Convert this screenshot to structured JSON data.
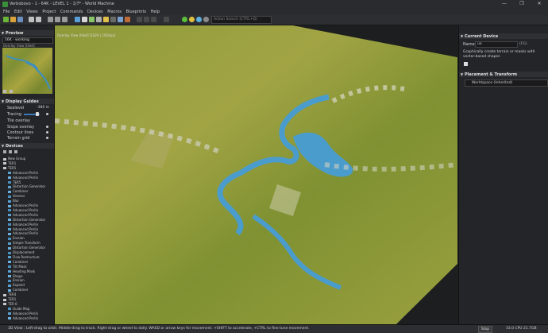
{
  "window": {
    "title": "Verbobovo - 1 - 64K - LEVEL 1 - 1/7* - World Machine",
    "min": "—",
    "max": "❐",
    "close": "✕"
  },
  "menu": [
    "File",
    "Edit",
    "Views",
    "Project",
    "Commands",
    "Devices",
    "Macros",
    "Blueprints",
    "Help"
  ],
  "toolbar": {
    "action_search_placeholder": "Action Search (CTRL+Q)"
  },
  "preview": {
    "header": "Preview",
    "selected": "16K - working",
    "overlay_label": "Overlay View [tiled]"
  },
  "display_guides": {
    "header": "Display Guides",
    "sealevel_label": "Sealevel",
    "sealevel_value": "-386 m",
    "tracing_label": "Tracing",
    "tile_overlay": "Tile overlay",
    "slope_overlay": "Slope overlay",
    "contour_lines": "Contour lines",
    "terrain_grid": "Terrain grid"
  },
  "devices": {
    "header": "Devices",
    "items": [
      {
        "label": "New Group",
        "kind": "group"
      },
      {
        "label": "TER1",
        "kind": "group"
      },
      {
        "label": "TER5",
        "kind": "group"
      },
      {
        "label": "Advanced Perlin",
        "kind": "node"
      },
      {
        "label": "Advanced Perlin",
        "kind": "node"
      },
      {
        "label": "TER5",
        "kind": "node"
      },
      {
        "label": "Distortion Generator",
        "kind": "node"
      },
      {
        "label": "Combiner",
        "kind": "node"
      },
      {
        "label": "Voronoi",
        "kind": "node"
      },
      {
        "label": "Blur",
        "kind": "node"
      },
      {
        "label": "Advanced Perlin",
        "kind": "node"
      },
      {
        "label": "Advanced Perlin",
        "kind": "node"
      },
      {
        "label": "Advanced Perlin",
        "kind": "node"
      },
      {
        "label": "Distortion Generator",
        "kind": "node"
      },
      {
        "label": "Advanced Perlin",
        "kind": "node"
      },
      {
        "label": "Advanced Perlin",
        "kind": "node"
      },
      {
        "label": "Advanced Perlin",
        "kind": "node"
      },
      {
        "label": "Erosion",
        "kind": "node"
      },
      {
        "label": "Simple Transform",
        "kind": "node"
      },
      {
        "label": "Distortion Generator",
        "kind": "node"
      },
      {
        "label": "Displacement",
        "kind": "node"
      },
      {
        "label": "Flow Restructure",
        "kind": "node"
      },
      {
        "label": "Combiner",
        "kind": "node"
      },
      {
        "label": "Tilt Mask",
        "kind": "node"
      },
      {
        "label": "Heading Mask",
        "kind": "node"
      },
      {
        "label": "Shape",
        "kind": "node"
      },
      {
        "label": "Erosion",
        "kind": "node"
      },
      {
        "label": "Expand",
        "kind": "node"
      },
      {
        "label": "Combiner",
        "kind": "node"
      },
      {
        "label": "TER4",
        "kind": "group"
      },
      {
        "label": "TER1",
        "kind": "group"
      },
      {
        "label": "TER 6",
        "kind": "group"
      },
      {
        "label": "Guide Map",
        "kind": "node"
      },
      {
        "label": "Advanced Perlin",
        "kind": "node"
      },
      {
        "label": "Advanced Perlin",
        "kind": "node"
      }
    ]
  },
  "viewport": {
    "label": "Overlay View [tiled] [1024 | 1024px]"
  },
  "current_device": {
    "header": "Current Device",
    "name_label": "Name",
    "name_value": "ue",
    "name_extra": "(FG)",
    "description": "Graphically create terrain or masks with vector-based shapes"
  },
  "placement": {
    "header": "Placement & Transform",
    "selected": "Worldspace (Inherited)"
  },
  "status": {
    "text": "3D View : Left-drag to orbit. Middle-drag to track. Right-drag or wheel to dolly. WASD or arrow keys for movement. +SHIFT to accelerate, +CTRL to fine tune movement.",
    "stop": "Stop",
    "perf": "33.0 CPU 21.7GB"
  },
  "colors": {
    "accent": "#3a78b8",
    "terrain_green": "#8a9a38",
    "water": "#4a9ccc"
  }
}
